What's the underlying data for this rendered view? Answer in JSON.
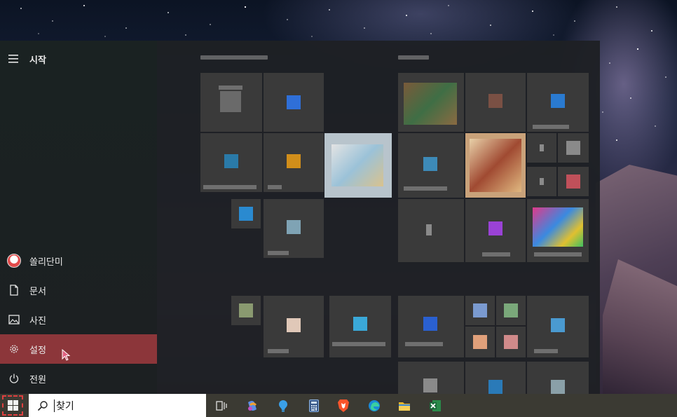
{
  "start_menu": {
    "header_label": "시작",
    "user_label": "쏠리단미",
    "items": [
      {
        "label": "문서",
        "icon": "document-icon"
      },
      {
        "label": "사진",
        "icon": "photo-icon"
      },
      {
        "label": "설정",
        "icon": "gear-icon"
      },
      {
        "label": "전원",
        "icon": "power-icon"
      }
    ],
    "active_item": "설정"
  },
  "taskbar": {
    "search_value": "찾기",
    "pinned_icons": [
      "task-view-icon",
      "copilot-icon",
      "cortana-icon",
      "calculator-icon",
      "brave-browser-icon",
      "edge-browser-icon",
      "file-explorer-icon",
      "excel-icon"
    ]
  },
  "colors": {
    "active_highlight": "#8c363a",
    "taskbar": "#3b3a33",
    "start_button_outline": "#e04040"
  }
}
